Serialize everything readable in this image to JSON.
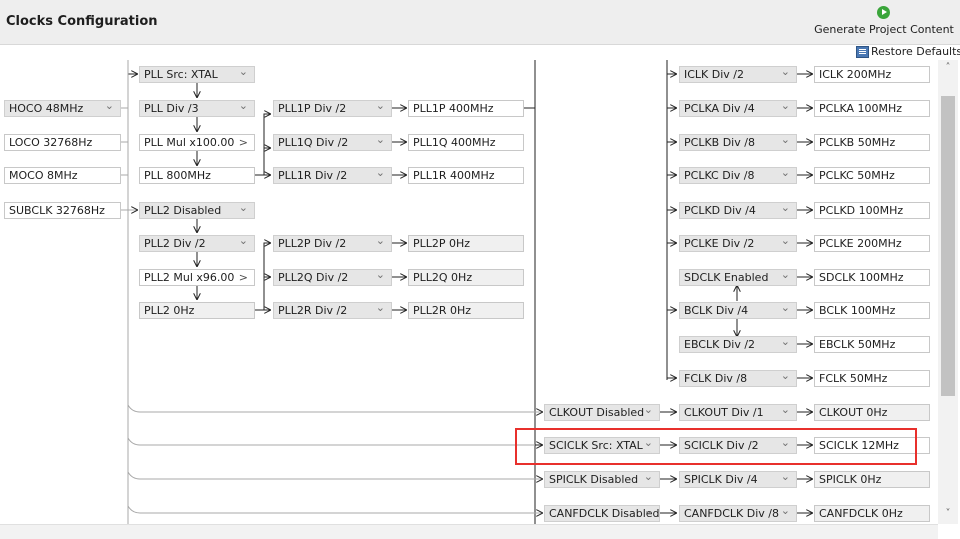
{
  "header": {
    "title": "Clocks Configuration",
    "generate_label": "Generate Project Content",
    "restore_label": "Restore Defaults"
  },
  "sources": {
    "hoco": "HOCO 48MHz",
    "loco": "LOCO 32768Hz",
    "moco": "MOCO 8MHz",
    "subclk": "SUBCLK 32768Hz"
  },
  "pll": {
    "src": "PLL Src: XTAL",
    "div": "PLL Div /3",
    "mul": "PLL Mul x100.00",
    "out": "PLL 800MHz",
    "p_div": "PLL1P Div /2",
    "q_div": "PLL1Q Div /2",
    "r_div": "PLL1R Div /2",
    "p_out": "PLL1P 400MHz",
    "q_out": "PLL1Q 400MHz",
    "r_out": "PLL1R 400MHz"
  },
  "pll2": {
    "state": "PLL2 Disabled",
    "div": "PLL2 Div /2",
    "mul": "PLL2 Mul x96.00",
    "out": "PLL2 0Hz",
    "p_div": "PLL2P Div /2",
    "q_div": "PLL2Q Div /2",
    "r_div": "PLL2R Div /2",
    "p_out": "PLL2P 0Hz",
    "q_out": "PLL2Q 0Hz",
    "r_out": "PLL2R 0Hz"
  },
  "system": {
    "iclk_div": "ICLK Div /2",
    "iclk": "ICLK 200MHz",
    "pclka_div": "PCLKA Div /4",
    "pclka": "PCLKA 100MHz",
    "pclkb_div": "PCLKB Div /8",
    "pclkb": "PCLKB 50MHz",
    "pclkc_div": "PCLKC Div /8",
    "pclkc": "PCLKC 50MHz",
    "pclkd_div": "PCLKD Div /4",
    "pclkd": "PCLKD 100MHz",
    "pclke_div": "PCLKE Div /2",
    "pclke": "PCLKE 200MHz",
    "sdclk_sel": "SDCLK Enabled",
    "sdclk": "SDCLK 100MHz",
    "bclk_div": "BCLK Div /4",
    "bclk": "BCLK 100MHz",
    "ebclk_div": "EBCLK Div /2",
    "ebclk": "EBCLK 50MHz",
    "fclk_div": "FCLK Div /8",
    "fclk": "FCLK 50MHz"
  },
  "peripheral": {
    "clkout_src": "CLKOUT Disabled",
    "clkout_div": "CLKOUT Div /1",
    "clkout": "CLKOUT 0Hz",
    "sciclk_src": "SCICLK Src: XTAL",
    "sciclk_div": "SCICLK Div /2",
    "sciclk": "SCICLK 12MHz",
    "spiclk_src": "SPICLK Disabled",
    "spiclk_div": "SPICLK Div /4",
    "spiclk": "SPICLK 0Hz",
    "canfdclk_src": "CANFDCLK Disabled",
    "canfdclk_div": "CANFDCLK Div /8",
    "canfdclk": "CANFDCLK 0Hz"
  },
  "colors": {
    "highlight": "#e8302c",
    "generate_icon": "#3aa53a",
    "dropdown_bg": "#e6e6e6"
  },
  "icons": {
    "generate": "play-circle-icon",
    "restore": "restore-defaults-icon"
  }
}
